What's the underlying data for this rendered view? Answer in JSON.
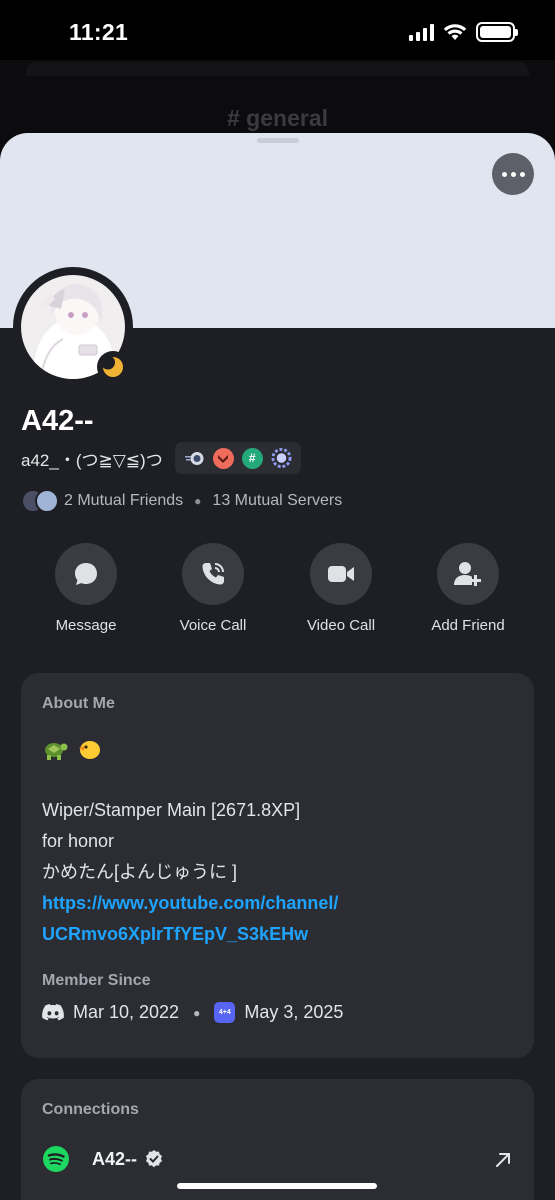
{
  "status_bar": {
    "time": "11:21"
  },
  "background": {
    "channel": "# general"
  },
  "profile": {
    "display_name": "A42--",
    "username": "a42_・(つ≧▽≦)つ",
    "mutual_friends": "2 Mutual Friends",
    "mutual_servers": "13 Mutual Servers",
    "badges": [
      "speed-badge",
      "rank-chevron-badge",
      "hashtag-badge",
      "laurel-badge"
    ]
  },
  "actions": [
    {
      "label": "Message",
      "icon": "chat-bubble-icon"
    },
    {
      "label": "Voice Call",
      "icon": "phone-icon"
    },
    {
      "label": "Video Call",
      "icon": "video-camera-icon"
    },
    {
      "label": "Add Friend",
      "icon": "add-person-icon"
    }
  ],
  "about": {
    "title": "About Me",
    "emojis": "🐢 🐤",
    "lines": [
      "Wiper/Stamper Main [2671.8XP]",
      "for honor",
      "かめたん[よんじゅうに ]"
    ],
    "link_line1": "https://www.youtube.com/channel/",
    "link_line2": "UCRmvo6XpIrTfYEpV_S3kEHw",
    "member_since_title": "Member Since",
    "discord_date": "Mar 10, 2022",
    "server_date": "May 3, 2025",
    "server_icon_text": "4+4"
  },
  "connections": {
    "title": "Connections",
    "service": "spotify-icon",
    "account": "A42--"
  },
  "colors": {
    "banner": "#e0e5f0",
    "link": "#1ea4ff",
    "spotify": "#1ed760",
    "idle": "#f0b232"
  }
}
